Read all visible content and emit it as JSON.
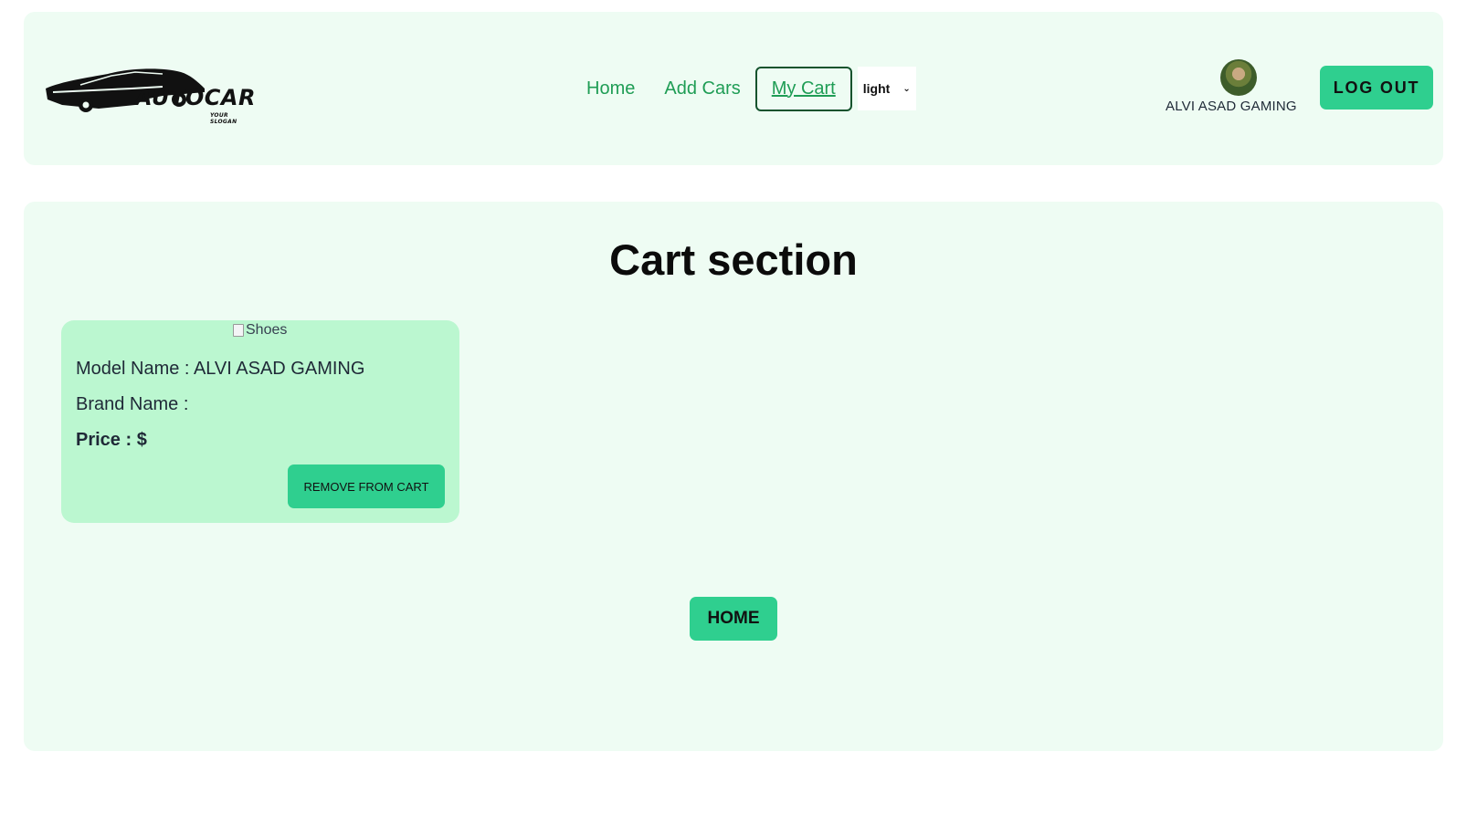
{
  "brand": {
    "name": "AUTOCAR",
    "slogan": "YOUR SLOGAN",
    "logo_icon": "car-silhouette-icon"
  },
  "nav": {
    "links": [
      {
        "label": "Home"
      },
      {
        "label": "Add Cars"
      },
      {
        "label": "My Cart"
      }
    ],
    "theme_select": {
      "value": "light"
    }
  },
  "user": {
    "name": "ALVI ASAD GAMING",
    "avatar_icon": "user-avatar-icon"
  },
  "logout_label": "LOG OUT",
  "main": {
    "title": "Cart section",
    "cart_items": [
      {
        "image_alt": "Shoes",
        "model_line": "Model Name : ALVI ASAD GAMING",
        "brand_line": "Brand Name :",
        "price_line": "Price : $",
        "remove_label": "REMOVE FROM CART"
      }
    ],
    "home_button_label": "HOME"
  },
  "colors": {
    "panel_bg": "#eefcf3",
    "card_bg": "#bbf7d0",
    "accent": "#2fcf8f",
    "link": "#1f9d55",
    "active_border": "#14532d"
  }
}
